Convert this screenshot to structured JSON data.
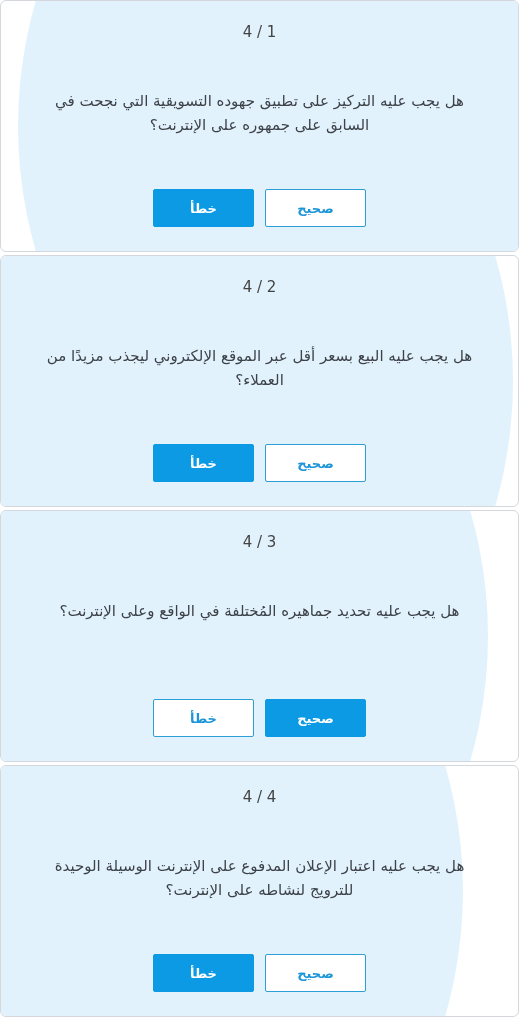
{
  "questions": [
    {
      "counter": "4 / 1",
      "text": "هل يجب عليه التركيز على تطبيق جهوده التسويقية التي نجحت في السابق على جمهوره على الإنترنت؟",
      "answers": [
        {
          "label": "صحيح",
          "selected": false
        },
        {
          "label": "خطأ",
          "selected": true
        }
      ]
    },
    {
      "counter": "4 / 2",
      "text": "هل يجب عليه البيع بسعر أقل عبر الموقع الإلكتروني ليجذب مزيدًا من العملاء؟",
      "answers": [
        {
          "label": "صحيح",
          "selected": false
        },
        {
          "label": "خطأ",
          "selected": true
        }
      ]
    },
    {
      "counter": "4 / 3",
      "text": "هل يجب عليه تحديد جماهيره المُختلفة في الواقع وعلى الإنترنت؟",
      "answers": [
        {
          "label": "صحيح",
          "selected": true
        },
        {
          "label": "خطأ",
          "selected": false
        }
      ]
    },
    {
      "counter": "4 / 4",
      "text": "هل يجب عليه اعتبار الإعلان المدفوع على الإنترنت الوسيلة الوحيدة للترويج لنشاطه على الإنترنت؟",
      "answers": [
        {
          "label": "صحيح",
          "selected": false
        },
        {
          "label": "خطأ",
          "selected": true
        }
      ]
    }
  ]
}
